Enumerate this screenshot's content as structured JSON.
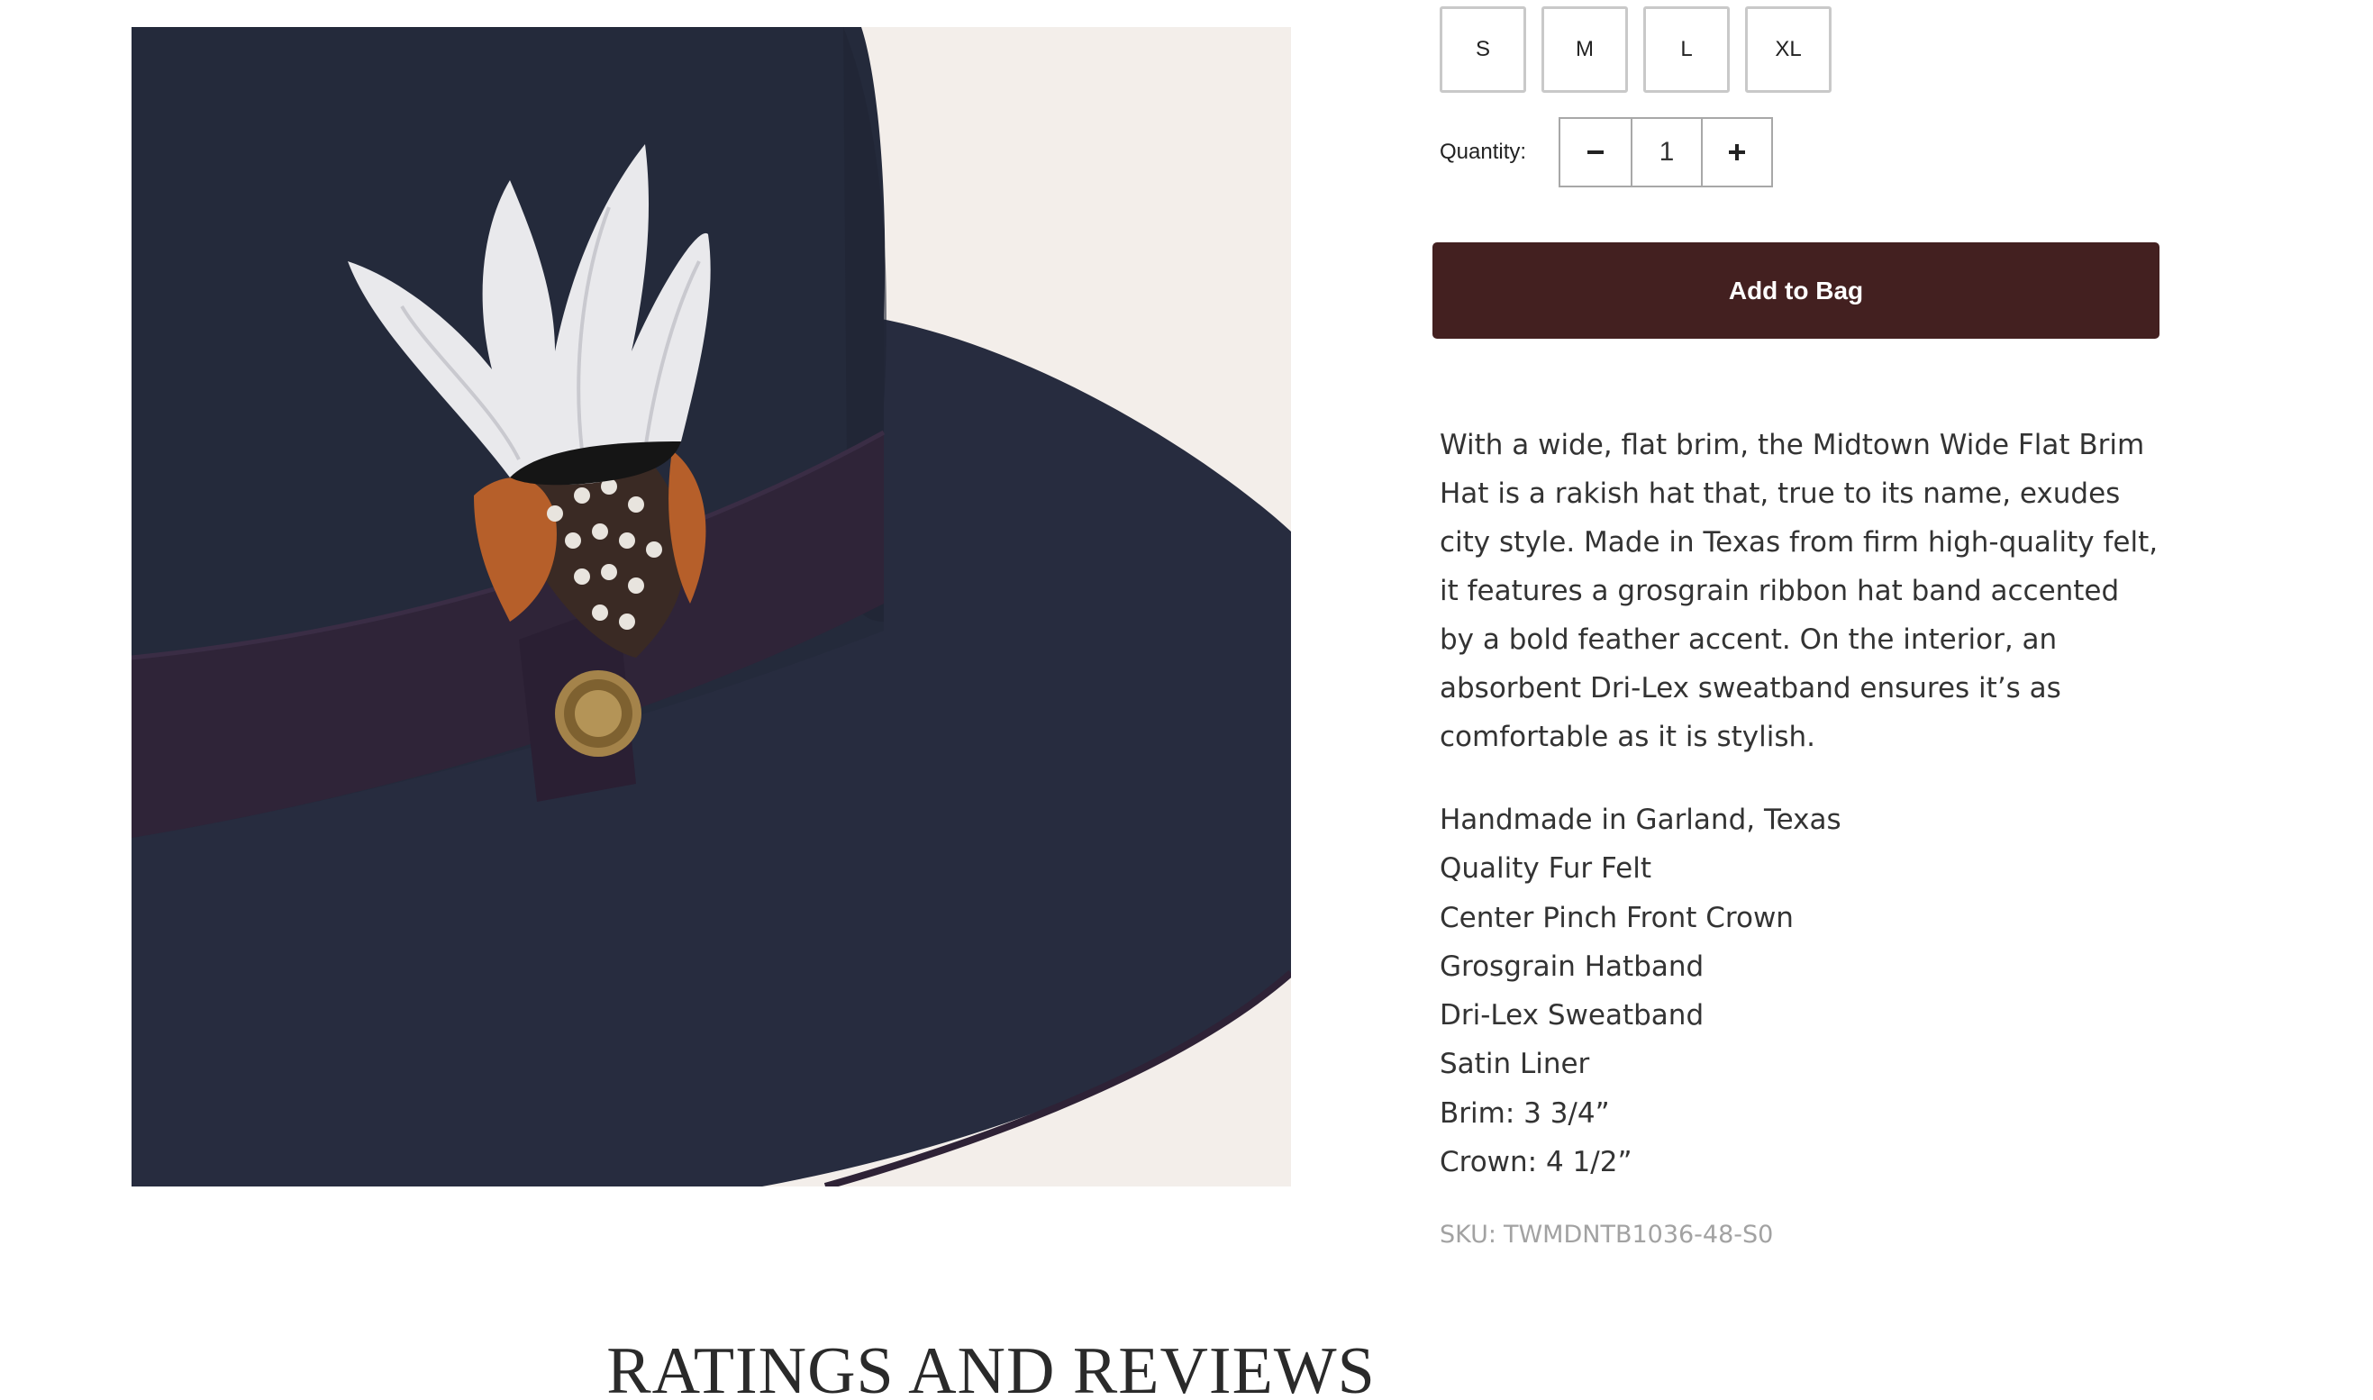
{
  "sizes": [
    {
      "label": "S"
    },
    {
      "label": "M"
    },
    {
      "label": "L"
    },
    {
      "label": "XL"
    }
  ],
  "quantity": {
    "label": "Quantity:",
    "decrement_icon": "minus-icon",
    "increment_icon": "plus-icon",
    "value": "1"
  },
  "add_to_bag_label": "Add to Bag",
  "description": "With a wide, flat brim, the Midtown Wide Flat Brim Hat is a rakish hat that, true to its name, exudes city style. Made in Texas from firm high-quality felt, it features a grosgrain ribbon hat band accented by a bold feather accent. On the interior, an absorbent Dri-Lex sweatband ensures it’s as comfortable as it is stylish.",
  "features": [
    "Handmade in Garland, Texas",
    "Quality Fur Felt",
    "Center Pinch Front Crown",
    "Grosgrain Hatband",
    "Dri-Lex Sweatband",
    "Satin Liner",
    "Brim: 3 3/4”",
    "Crown: 4 1/2”"
  ],
  "sku": {
    "label": "SKU:",
    "value": "TWMDNTB1036-48-S0"
  },
  "reviews_title": "RATINGS AND REVIEWS",
  "colors": {
    "button_bg": "#432020",
    "hat": "#262b3d",
    "band": "#2e2236",
    "image_bg": "#f3eeea",
    "sku_text": "#a2a2a2"
  }
}
